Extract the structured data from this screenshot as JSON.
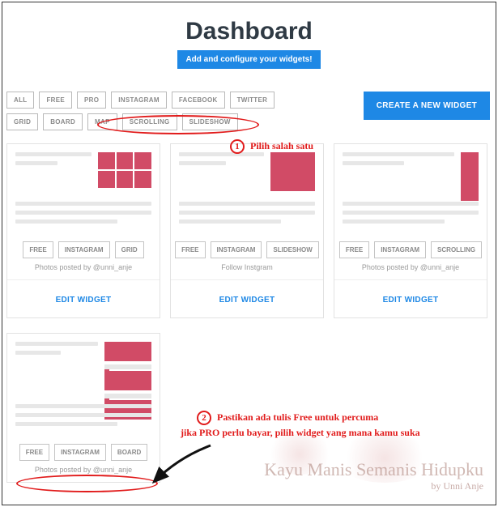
{
  "header": {
    "title": "Dashboard",
    "subtitle": "Add and configure your widgets!"
  },
  "filters": {
    "row1": [
      "ALL",
      "FREE",
      "PRO",
      "INSTAGRAM",
      "FACEBOOK",
      "TWITTER"
    ],
    "row2": [
      "GRID",
      "BOARD",
      "MAP",
      "SCROLLING",
      "SLIDESHOW"
    ]
  },
  "cta_label": "CREATE A NEW WIDGET",
  "cards": [
    {
      "tags": [
        "FREE",
        "INSTAGRAM",
        "GRID"
      ],
      "caption": "Photos posted by @unni_anje",
      "edit_label": "EDIT WIDGET",
      "preview_style": "grid"
    },
    {
      "tags": [
        "FREE",
        "INSTAGRAM",
        "SLIDESHOW"
      ],
      "caption": "Follow Instgram",
      "edit_label": "EDIT WIDGET",
      "preview_style": "single"
    },
    {
      "tags": [
        "FREE",
        "INSTAGRAM",
        "SCROLLING"
      ],
      "caption": "Photos posted by @unni_anje",
      "edit_label": "EDIT WIDGET",
      "preview_style": "tall"
    },
    {
      "tags": [
        "FREE",
        "INSTAGRAM",
        "BOARD"
      ],
      "caption": "Photos posted by @unni_anje",
      "edit_label": "",
      "preview_style": "board"
    }
  ],
  "annotations": {
    "one_label": "Pilih salah satu",
    "one_num": "1",
    "two_num": "2",
    "two_line1": "Pastikan ada tulis Free untuk percuma",
    "two_line2": "jika PRO perlu bayar, pilih widget yang mana kamu suka"
  },
  "watermark": {
    "main": "Kayu Manis Semanis Hidupku",
    "by": "by Unni Anje"
  }
}
